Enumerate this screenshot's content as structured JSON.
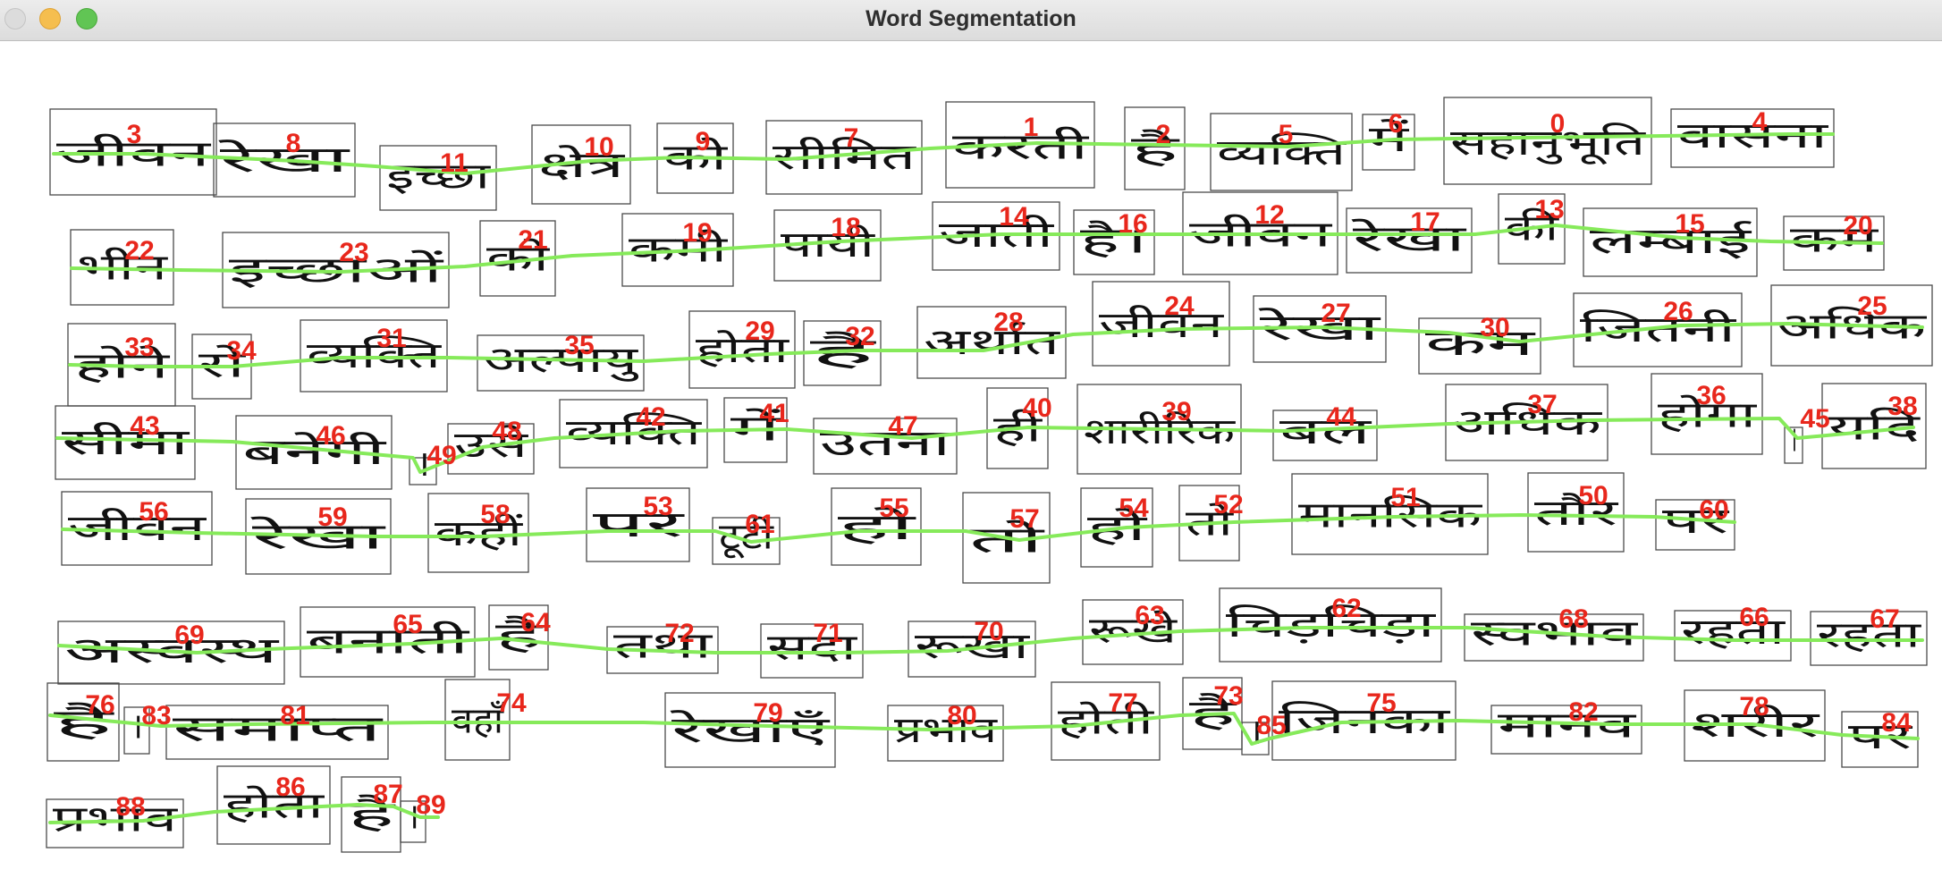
{
  "window": {
    "title": "Word Segmentation",
    "controls": {
      "close": "close-button",
      "minimize": "minimize-button",
      "zoom": "zoom-button"
    }
  },
  "colors": {
    "box": "#4a4a4a",
    "label": "#e8271c",
    "line": "#86ea5a",
    "ink": "#111111"
  },
  "words": [
    {
      "id": "3",
      "text": "जीवन"
    },
    {
      "id": "8",
      "text": "रेखा"
    },
    {
      "id": "11",
      "text": "इच्छा"
    },
    {
      "id": "10",
      "text": "क्षेत्र"
    },
    {
      "id": "9",
      "text": "को"
    },
    {
      "id": "7",
      "text": "सीमित"
    },
    {
      "id": "1",
      "text": "करती"
    },
    {
      "id": "2",
      "text": "है"
    },
    {
      "id": "5",
      "text": "व्यक्ति"
    },
    {
      "id": "6",
      "text": "में"
    },
    {
      "id": "0",
      "text": "सहानुभूति"
    },
    {
      "id": "4",
      "text": "वासना"
    },
    {
      "id": "22",
      "text": "भीन"
    },
    {
      "id": "23",
      "text": "इच्छाओं"
    },
    {
      "id": "21",
      "text": "को"
    },
    {
      "id": "19",
      "text": "कमी"
    },
    {
      "id": "18",
      "text": "पायी"
    },
    {
      "id": "14",
      "text": "जाती"
    },
    {
      "id": "16",
      "text": "है।"
    },
    {
      "id": "12",
      "text": "जीवन"
    },
    {
      "id": "17",
      "text": "रेखा"
    },
    {
      "id": "13",
      "text": "की"
    },
    {
      "id": "15",
      "text": "लम्बाई"
    },
    {
      "id": "20",
      "text": "कम"
    },
    {
      "id": "33",
      "text": "होने"
    },
    {
      "id": "34",
      "text": "से"
    },
    {
      "id": "31",
      "text": "व्यक्ति"
    },
    {
      "id": "35",
      "text": "अल्पायु"
    },
    {
      "id": "29",
      "text": "होता"
    },
    {
      "id": "32",
      "text": "है"
    },
    {
      "id": "28",
      "text": "अर्थात"
    },
    {
      "id": "24",
      "text": "जीवन"
    },
    {
      "id": "27",
      "text": "रेखा"
    },
    {
      "id": "30",
      "text": "कम"
    },
    {
      "id": "26",
      "text": "जितनी"
    },
    {
      "id": "25",
      "text": "अधिक"
    },
    {
      "id": "43",
      "text": "सीमा"
    },
    {
      "id": "46",
      "text": "बनेगी"
    },
    {
      "id": "49",
      "text": "।"
    },
    {
      "id": "48",
      "text": "उसे"
    },
    {
      "id": "42",
      "text": "व्यक्ति"
    },
    {
      "id": "41",
      "text": "में"
    },
    {
      "id": "47",
      "text": "उतना"
    },
    {
      "id": "40",
      "text": "ही"
    },
    {
      "id": "39",
      "text": "शारीरिक"
    },
    {
      "id": "44",
      "text": "बल"
    },
    {
      "id": "37",
      "text": "अधिक"
    },
    {
      "id": "36",
      "text": "होगा"
    },
    {
      "id": "45",
      "text": "।"
    },
    {
      "id": "38",
      "text": "यदि"
    },
    {
      "id": "56",
      "text": "जीवन"
    },
    {
      "id": "59",
      "text": "रेखा"
    },
    {
      "id": "58",
      "text": "कहीं"
    },
    {
      "id": "53",
      "text": "पर"
    },
    {
      "id": "61",
      "text": "टूटी"
    },
    {
      "id": "55",
      "text": "हो"
    },
    {
      "id": "57",
      "text": "तो"
    },
    {
      "id": "54",
      "text": "हो"
    },
    {
      "id": "52",
      "text": "तो"
    },
    {
      "id": "51",
      "text": "मानसिक"
    },
    {
      "id": "50",
      "text": "तौर"
    },
    {
      "id": "60",
      "text": "पर"
    },
    {
      "id": "69",
      "text": "अस्वस्थ"
    },
    {
      "id": "65",
      "text": "बनाती"
    },
    {
      "id": "64",
      "text": "है"
    },
    {
      "id": "72",
      "text": "तथा"
    },
    {
      "id": "71",
      "text": "सदा"
    },
    {
      "id": "70",
      "text": "रूखा"
    },
    {
      "id": "63",
      "text": "रूखे"
    },
    {
      "id": "62",
      "text": "चिड़चिड़ा"
    },
    {
      "id": "68",
      "text": "स्वभाव"
    },
    {
      "id": "66",
      "text": "रहता"
    },
    {
      "id": "67",
      "text": "रहता"
    },
    {
      "id": "76",
      "text": "है"
    },
    {
      "id": "83",
      "text": "।"
    },
    {
      "id": "81",
      "text": "समाप्त"
    },
    {
      "id": "74",
      "text": "वहाँ"
    },
    {
      "id": "79",
      "text": "रेखाएँ"
    },
    {
      "id": "80",
      "text": "प्रभाव"
    },
    {
      "id": "77",
      "text": "होती"
    },
    {
      "id": "73",
      "text": "है"
    },
    {
      "id": "85",
      "text": "।"
    },
    {
      "id": "75",
      "text": "जिनका"
    },
    {
      "id": "82",
      "text": "मानव"
    },
    {
      "id": "78",
      "text": "शरीर"
    },
    {
      "id": "84",
      "text": "पर"
    },
    {
      "id": "88",
      "text": "प्रभाव"
    },
    {
      "id": "86",
      "text": "होता"
    },
    {
      "id": "87",
      "text": "है"
    },
    {
      "id": "89",
      "text": "।"
    }
  ]
}
